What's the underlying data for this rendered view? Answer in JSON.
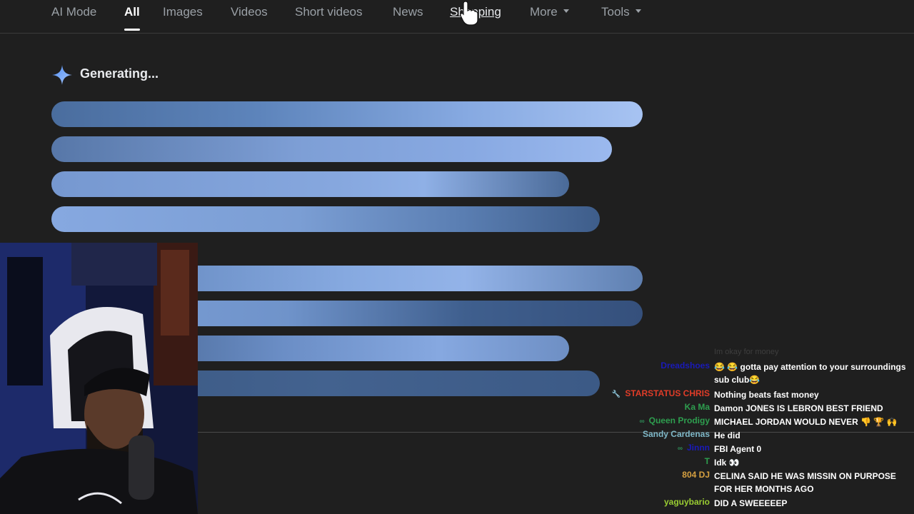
{
  "tabs": [
    {
      "label": "AI Mode"
    },
    {
      "label": "All"
    },
    {
      "label": "Images"
    },
    {
      "label": "Videos"
    },
    {
      "label": "Short videos"
    },
    {
      "label": "News"
    },
    {
      "label": "Shopping"
    },
    {
      "label": "More"
    },
    {
      "label": "Tools"
    }
  ],
  "ai_overview": {
    "status": "Generating...",
    "icon": "sparkle-icon",
    "accent_color": "#8ab4f8"
  },
  "chat": {
    "faded_line": "Im okay for money",
    "messages": [
      {
        "user": "Dreadshoes",
        "color": "#1a1ab8",
        "text": "😂 😂 gotta pay attention to your surroundings sub club😂"
      },
      {
        "user": "STARSTATUS CHRIS",
        "color": "#e03c28",
        "text": "Nothing beats fast money"
      },
      {
        "user": "Ka Ma",
        "color": "#2e9e4f",
        "text": "Damon JONES IS LEBRON BEST FRIEND"
      },
      {
        "user": "Queen Prodigy",
        "color": "#2e9e4f",
        "text": "MICHAEL JORDAN WOULD NEVER 👎 🏆 🙌"
      },
      {
        "user": "Sandy Cardenas",
        "color": "#7fb8c8",
        "text": "He did"
      },
      {
        "user": "Jinnn",
        "color": "#1a1ab8",
        "text": "FBI Agent 0"
      },
      {
        "user": "T",
        "color": "#2e9e4f",
        "text": "Idk 👀"
      },
      {
        "user": "804 DJ",
        "color": "#d6a040",
        "text": "CELINA SAID HE WAS MISSIN ON PURPOSE FOR HER MONTHS AGO"
      },
      {
        "user": "yaguybario",
        "color": "#9acd32",
        "text": "DID A SWEEEEEP"
      }
    ]
  }
}
